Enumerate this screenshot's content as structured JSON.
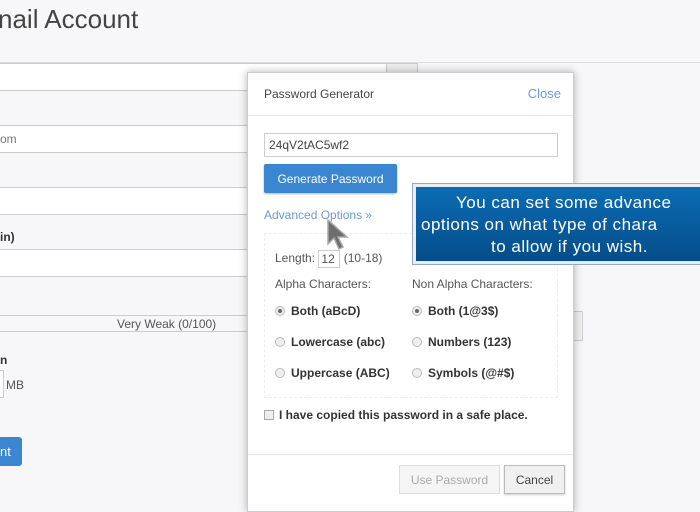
{
  "page": {
    "title": "nail Account",
    "domain_field": "om",
    "field_label": "in)",
    "strength": "Very Weak (0/100)",
    "quota_label": "n",
    "quota_unit": "MB",
    "create_button": "nt"
  },
  "modal": {
    "title": "Password Generator",
    "close": "Close",
    "password": "24qV2tAC5wf2",
    "generate": "Generate Password",
    "advanced": "Advanced Options »",
    "length_label": "Length:",
    "length_value": "12",
    "length_range": "(10-18)",
    "alpha_label": "Alpha Characters:",
    "nonalpha_label": "Non Alpha Characters:",
    "alpha_options": [
      {
        "label": "Both (aBcD)",
        "selected": true
      },
      {
        "label": "Lowercase (abc)",
        "selected": false
      },
      {
        "label": "Uppercase (ABC)",
        "selected": false
      }
    ],
    "nonalpha_options": [
      {
        "label": "Both (1@3$)",
        "selected": true
      },
      {
        "label": "Numbers (123)",
        "selected": false
      },
      {
        "label": "Symbols (@#$)",
        "selected": false
      }
    ],
    "copied_label": "I have copied this password in a safe place.",
    "copied_checked": false,
    "use_password": "Use Password",
    "cancel": "Cancel"
  },
  "tooltip": {
    "line1": "You can set some advance",
    "line2": "options on what type of chara",
    "line3": "to allow if you wish."
  },
  "colors": {
    "accent": "#3b86d0",
    "link": "#6b9bd1",
    "tooltip": "#0b6cb3"
  }
}
